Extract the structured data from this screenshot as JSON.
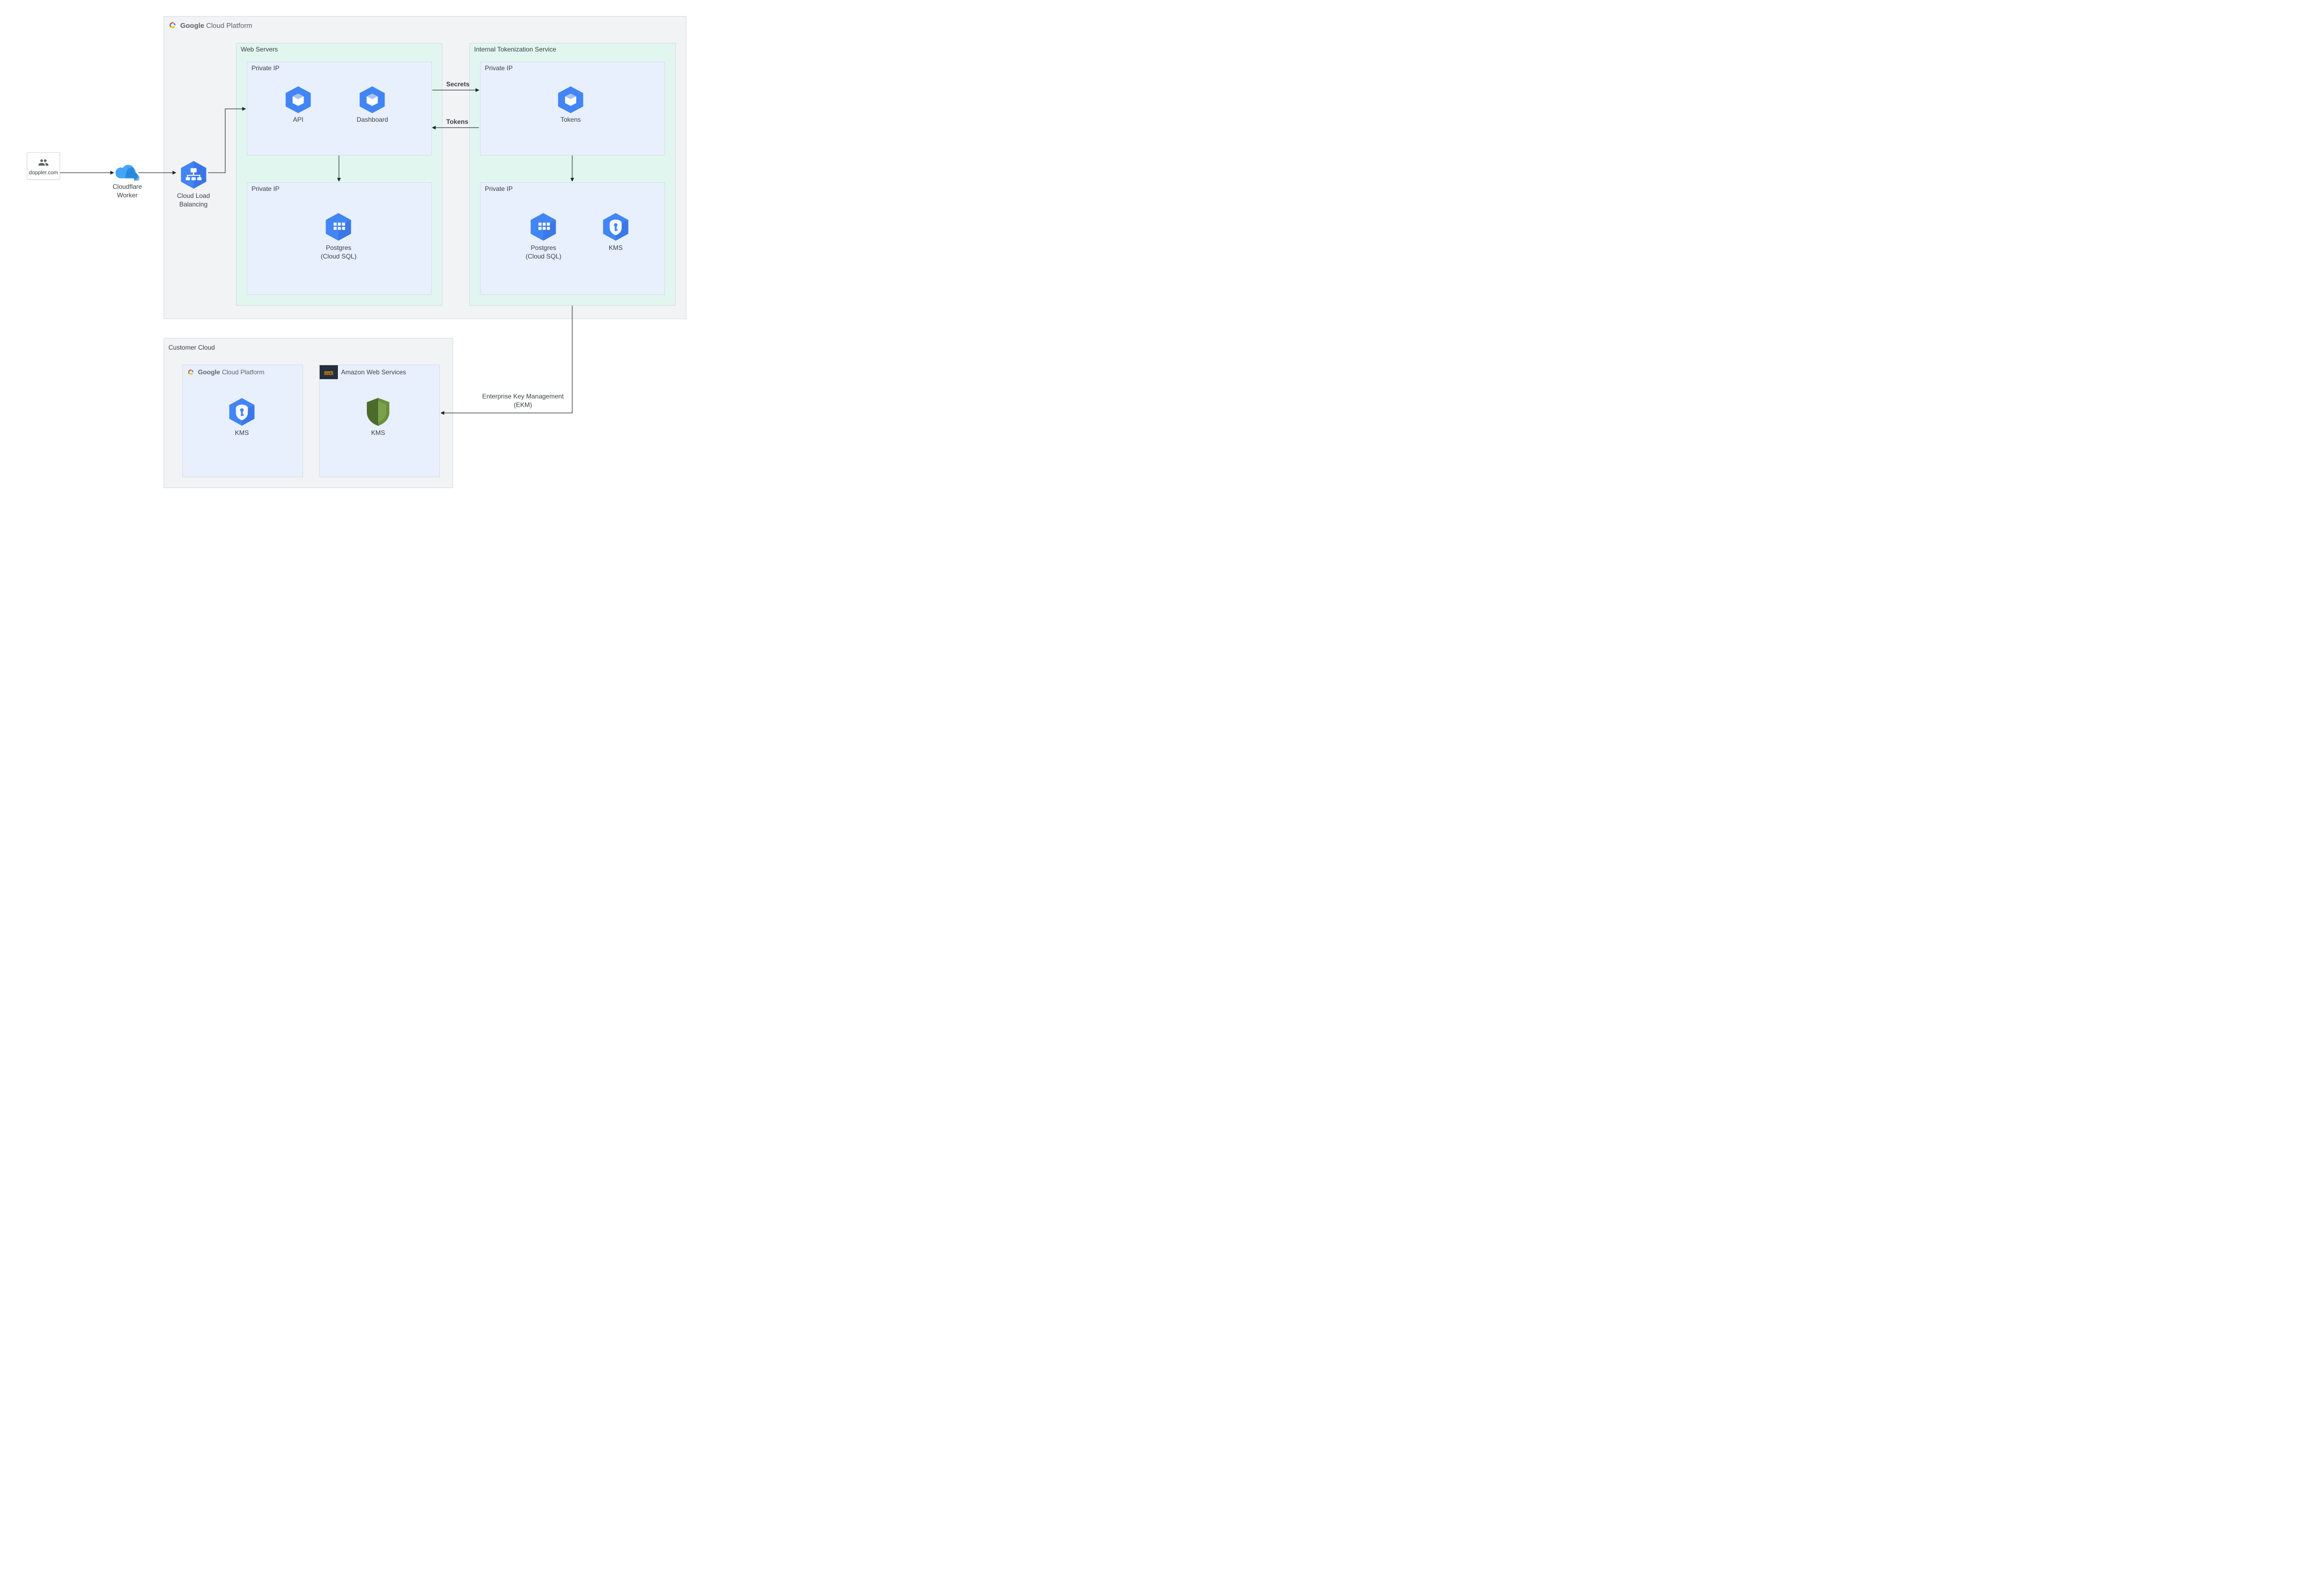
{
  "entry": {
    "doppler": "doppler.com",
    "cloudflare": "Cloudflare\nWorker"
  },
  "gcp": {
    "brand_bold": "Google",
    "brand_light": "Cloud Platform",
    "load_balancer": "Cloud Load\nBalancing",
    "web_servers": {
      "title": "Web Servers",
      "top": {
        "label": "Private IP",
        "api": "API",
        "dashboard": "Dashboard"
      },
      "bottom": {
        "label": "Private IP",
        "postgres": "Postgres\n(Cloud SQL)"
      }
    },
    "tokenization": {
      "title": "Internal Tokenization Service",
      "top": {
        "label": "Private IP",
        "tokens": "Tokens"
      },
      "bottom": {
        "label": "Private IP",
        "postgres": "Postgres\n(Cloud SQL)",
        "kms": "KMS"
      }
    },
    "edges": {
      "secrets": "Secrets",
      "tokens": "Tokens"
    }
  },
  "customer": {
    "title": "Customer Cloud",
    "gcp": {
      "brand_bold": "Google",
      "brand_light": "Cloud Platform",
      "kms": "KMS"
    },
    "aws": {
      "title": "Amazon Web Services",
      "kms": "KMS"
    }
  },
  "ekm": "Enterprise Key Management\n(EKM)"
}
